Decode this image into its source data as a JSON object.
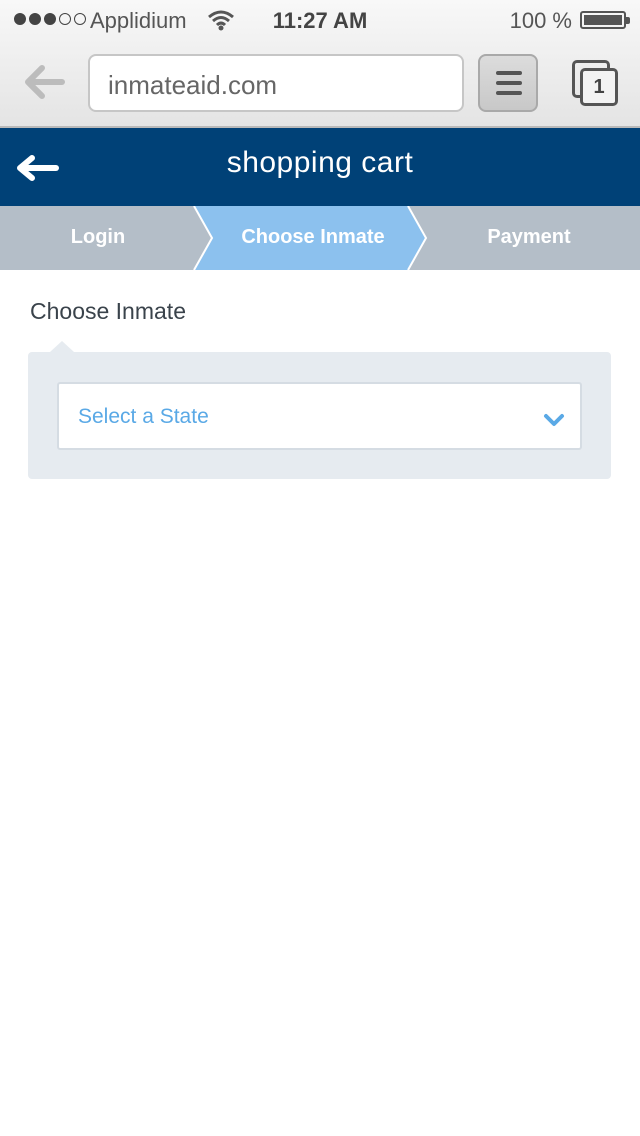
{
  "status_bar": {
    "carrier": "Applidium",
    "time": "11:27 AM",
    "battery": "100 %"
  },
  "browser": {
    "url": "inmateaid.com",
    "tab_count": "1"
  },
  "header": {
    "title": "shopping cart"
  },
  "stepper": {
    "steps": [
      {
        "label": "Login",
        "active": false
      },
      {
        "label": "Choose Inmate",
        "active": true
      },
      {
        "label": "Payment",
        "active": false
      }
    ]
  },
  "main": {
    "section_title": "Choose Inmate",
    "state_select": {
      "selected": "Select a State"
    }
  },
  "colors": {
    "header_bg": "#004177",
    "stepper_bg": "#b4bec8",
    "step_active": "#8cc1ee",
    "select_text": "#5aa9e6",
    "panel_bg": "#e6ebf0"
  },
  "icons": [
    "signal-dots-icon",
    "wifi-icon",
    "battery-icon",
    "back-arrow-icon",
    "menu-icon",
    "tabs-icon",
    "chevron-down-icon"
  ]
}
